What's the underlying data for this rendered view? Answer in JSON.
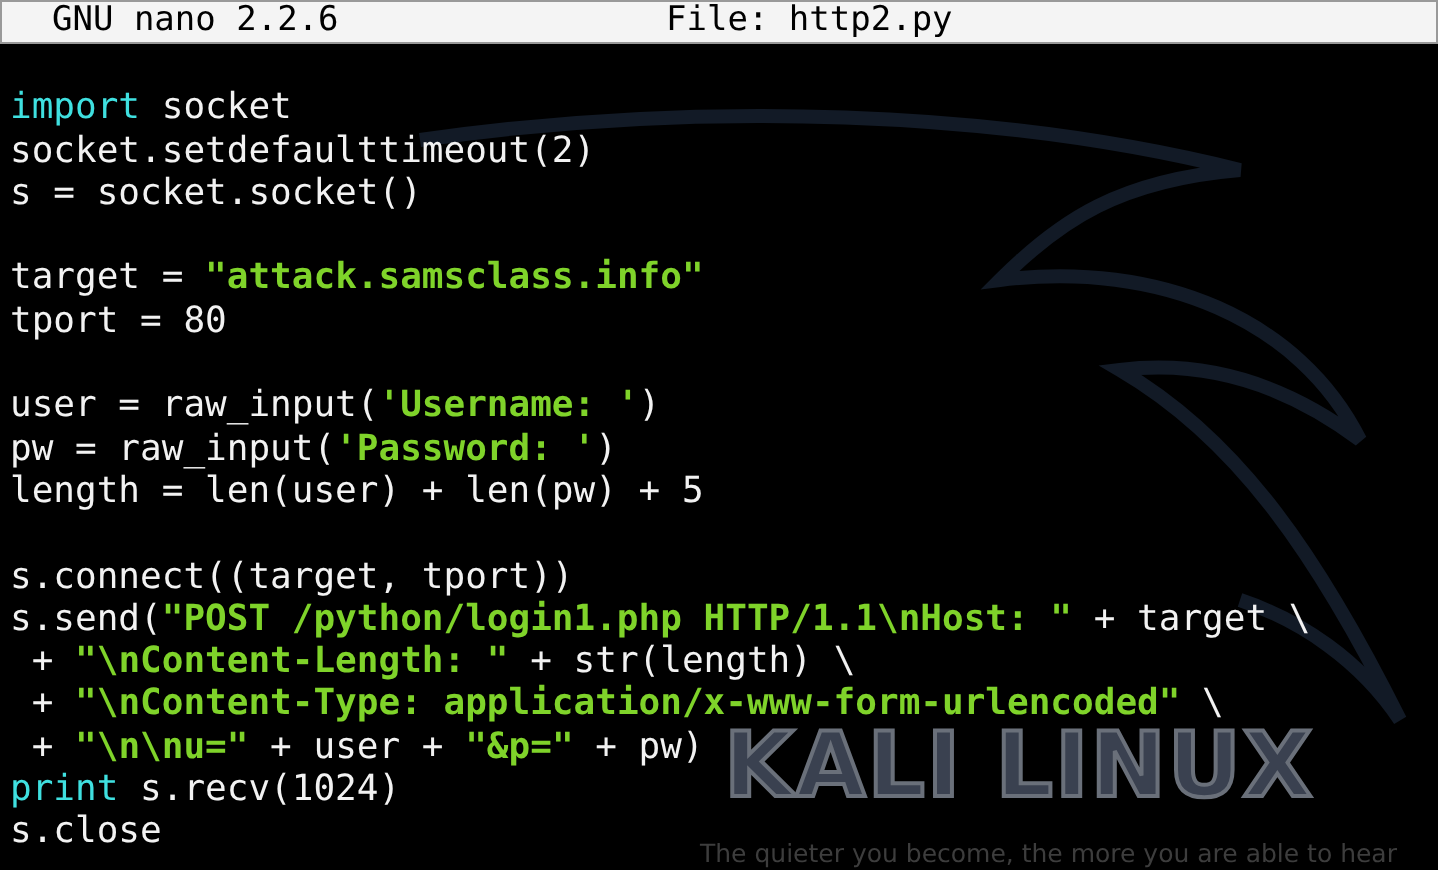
{
  "title_bar": {
    "app": "GNU nano 2.2.6",
    "file": "File: http2.py"
  },
  "lines": [
    {
      "kind": "blank"
    },
    {
      "kind": "code",
      "tokens": [
        {
          "kind": "keyword",
          "text": "import"
        },
        {
          "kind": "plain",
          "text": " socket"
        }
      ]
    },
    {
      "kind": "code",
      "tokens": [
        {
          "kind": "plain",
          "text": "socket.setdefaulttimeout(2)"
        }
      ]
    },
    {
      "kind": "code",
      "tokens": [
        {
          "kind": "plain",
          "text": "s = socket.socket()"
        }
      ]
    },
    {
      "kind": "blank"
    },
    {
      "kind": "code",
      "tokens": [
        {
          "kind": "plain",
          "text": "target = "
        },
        {
          "kind": "string",
          "text": "\"attack.samsclass.info\""
        }
      ]
    },
    {
      "kind": "code",
      "tokens": [
        {
          "kind": "plain",
          "text": "tport = 80"
        }
      ]
    },
    {
      "kind": "blank"
    },
    {
      "kind": "code",
      "tokens": [
        {
          "kind": "plain",
          "text": "user = raw_input("
        },
        {
          "kind": "string",
          "text": "'Username: '"
        },
        {
          "kind": "plain",
          "text": ")"
        }
      ]
    },
    {
      "kind": "code",
      "tokens": [
        {
          "kind": "plain",
          "text": "pw = raw_input("
        },
        {
          "kind": "string",
          "text": "'Password: '"
        },
        {
          "kind": "plain",
          "text": ")"
        }
      ]
    },
    {
      "kind": "code",
      "tokens": [
        {
          "kind": "plain",
          "text": "length = len(user) + len(pw) + 5"
        }
      ]
    },
    {
      "kind": "blank"
    },
    {
      "kind": "code",
      "tokens": [
        {
          "kind": "plain",
          "text": "s.connect((target, tport))"
        }
      ]
    },
    {
      "kind": "code",
      "tokens": [
        {
          "kind": "plain",
          "text": "s.send("
        },
        {
          "kind": "string",
          "text": "\"POST /python/login1.php HTTP/1.1\\nHost: \""
        },
        {
          "kind": "plain",
          "text": " + target \\"
        }
      ]
    },
    {
      "kind": "code",
      "tokens": [
        {
          "kind": "plain",
          "text": " + "
        },
        {
          "kind": "string",
          "text": "\"\\nContent-Length: \""
        },
        {
          "kind": "plain",
          "text": " + str(length) \\"
        }
      ]
    },
    {
      "kind": "code",
      "tokens": [
        {
          "kind": "plain",
          "text": " + "
        },
        {
          "kind": "string",
          "text": "\"\\nContent-Type: application/x-www-form-urlencoded\""
        },
        {
          "kind": "plain",
          "text": " \\"
        }
      ]
    },
    {
      "kind": "code",
      "tokens": [
        {
          "kind": "plain",
          "text": " + "
        },
        {
          "kind": "string",
          "text": "\"\\n\\nu=\""
        },
        {
          "kind": "plain",
          "text": " + user + "
        },
        {
          "kind": "string",
          "text": "\"&p=\""
        },
        {
          "kind": "plain",
          "text": " + pw)"
        }
      ]
    },
    {
      "kind": "code",
      "tokens": [
        {
          "kind": "keyword",
          "text": "print"
        },
        {
          "kind": "plain",
          "text": " s.recv(1024)"
        }
      ]
    },
    {
      "kind": "code",
      "tokens": [
        {
          "kind": "plain",
          "text": "s.close"
        }
      ]
    }
  ],
  "wallpaper": {
    "logo": "KALI LINUX",
    "tagline": "The quieter you become, the more you are able to hear"
  }
}
